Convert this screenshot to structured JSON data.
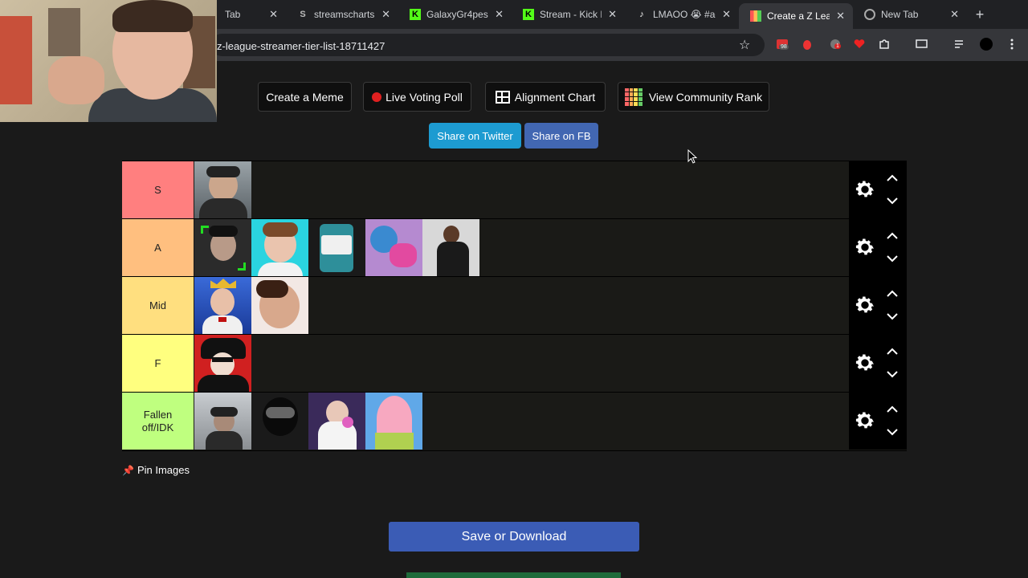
{
  "browser": {
    "tabs": [
      {
        "title": "Tab",
        "active": false
      },
      {
        "title": "streamscharts",
        "active": false
      },
      {
        "title": "GalaxyGr4pes",
        "active": false
      },
      {
        "title": "Stream - Kick D",
        "active": false
      },
      {
        "title": "LMAOO 😭 #ac",
        "active": false
      },
      {
        "title": "Create a Z Leag",
        "active": true
      },
      {
        "title": "New Tab",
        "active": false
      }
    ],
    "url": "z-league-streamer-tier-list-18711427",
    "extension_badges": {
      "first": "98",
      "second": "1"
    }
  },
  "page": {
    "top_buttons": {
      "meme": "Create a Meme",
      "poll": "Live Voting Poll",
      "alignment": "Alignment Chart",
      "community": "View Community Rank"
    },
    "share": {
      "twitter": "Share on Twitter",
      "facebook": "Share on FB"
    },
    "tiers": [
      {
        "label": "S",
        "color": "#ff7f7f",
        "item_count": 1
      },
      {
        "label": "A",
        "color": "#ffbf7f",
        "item_count": 5
      },
      {
        "label": "Mid",
        "color": "#ffdf7f",
        "item_count": 2
      },
      {
        "label": "F",
        "color": "#ffff7f",
        "item_count": 1
      },
      {
        "label": "Fallen off/IDK",
        "color": "#bfff7f",
        "item_count": 4
      }
    ],
    "pin_images_label": "Pin Images",
    "save_label": "Save or Download"
  },
  "colors": {
    "twitter": "#1da1f2",
    "facebook": "#4267b2",
    "save": "#3b5cb5"
  }
}
